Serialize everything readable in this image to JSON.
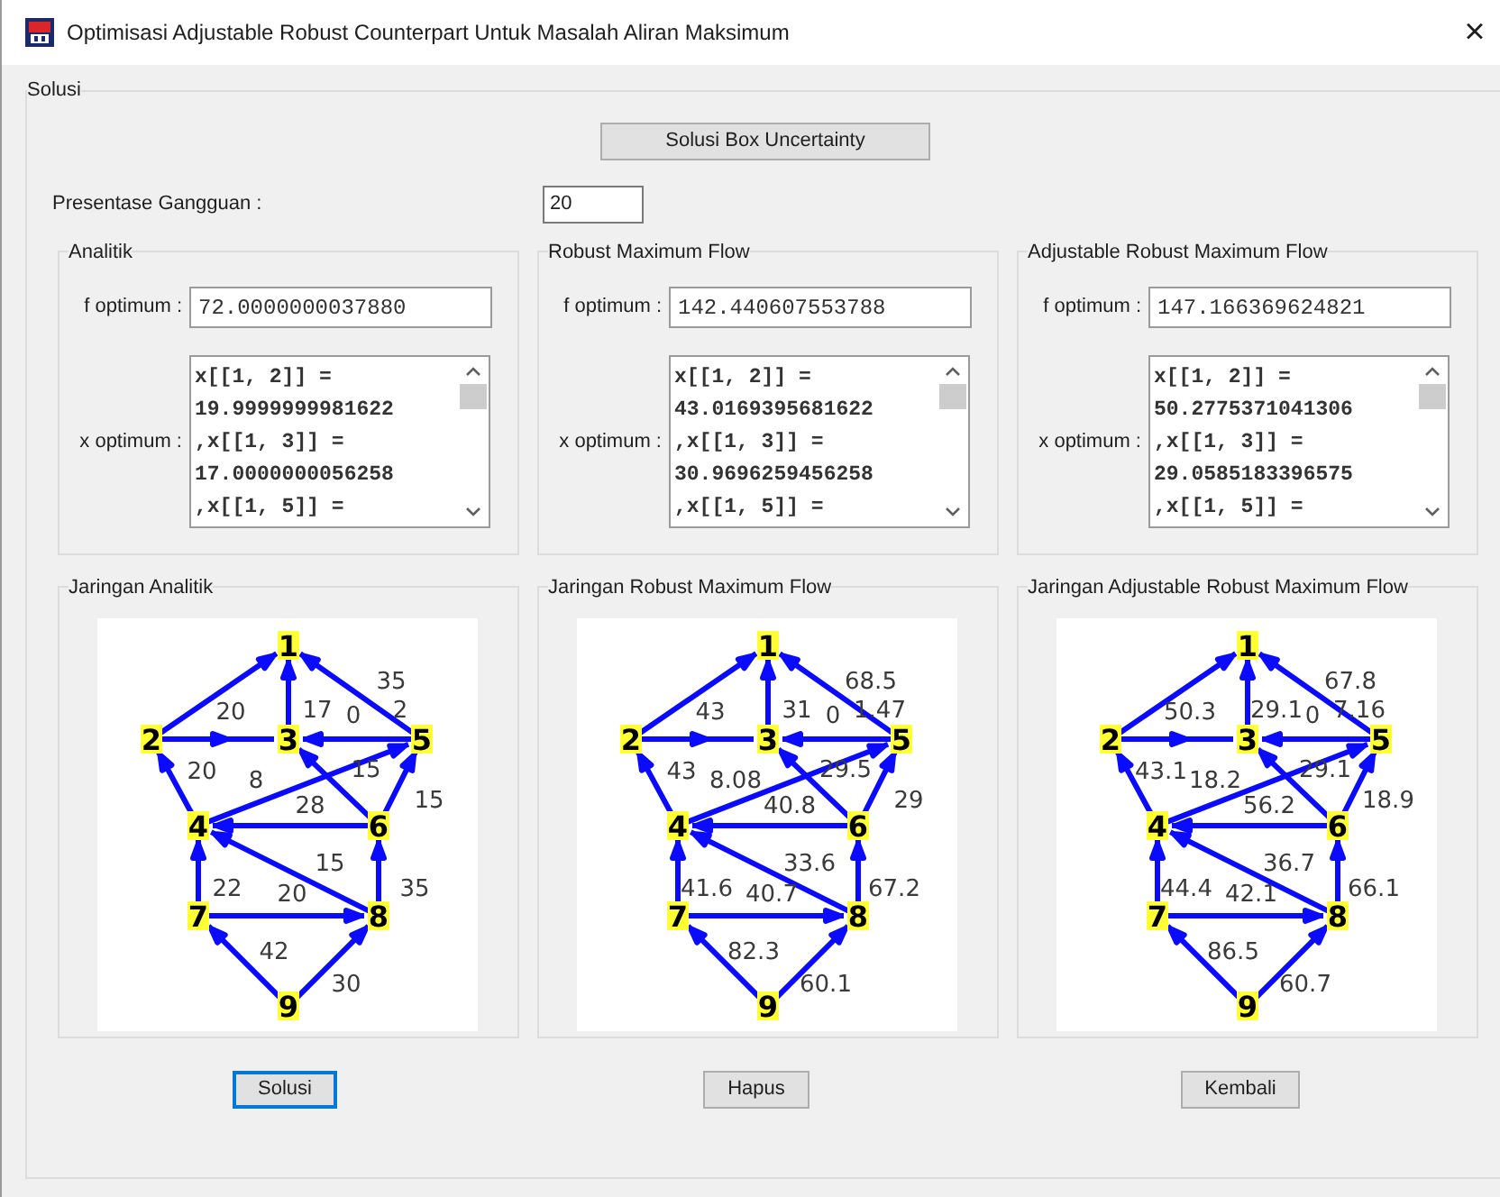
{
  "window": {
    "title": "Optimisasi Adjustable Robust Counterpart Untuk Masalah Aliran Maksimum",
    "close": "×"
  },
  "group": {
    "title": "Solusi"
  },
  "box_button": "Solusi Box Uncertainty",
  "disturbance": {
    "label": "Presentase Gangguan :",
    "value": "20"
  },
  "results": [
    {
      "title": "Analitik",
      "f_label": "f optimum :",
      "f_value": "72.0000000037880",
      "x_label": "x optimum :",
      "x_lines": [
        "x[[1, 2]] =",
        "19.9999999981622",
        ",x[[1, 3]] =",
        "17.0000000056258",
        ",x[[1, 5]] ="
      ]
    },
    {
      "title": "Robust Maximum Flow",
      "f_label": "f optimum :",
      "f_value": "142.440607553788",
      "x_label": "x optimum :",
      "x_lines": [
        "x[[1, 2]] =",
        "43.0169395681622",
        ",x[[1, 3]] =",
        "30.9696259456258",
        ",x[[1, 5]] ="
      ]
    },
    {
      "title": "Adjustable Robust Maximum Flow",
      "f_label": "f optimum :",
      "f_value": "147.166369624821",
      "x_label": "x optimum :",
      "x_lines": [
        "x[[1, 2]] =",
        "50.2775371041306",
        ",x[[1, 3]] =",
        "29.0585183396575",
        ",x[[1, 5]] ="
      ]
    }
  ],
  "networks": [
    {
      "title": "Jaringan Analitik",
      "nodes": [
        "1",
        "2",
        "3",
        "4",
        "5",
        "6",
        "7",
        "8",
        "9"
      ],
      "edge_labels": [
        "35",
        "20",
        "17",
        "0",
        "2",
        "20",
        "8",
        "15",
        "28",
        "15",
        "15",
        "22",
        "20",
        "35",
        "42",
        "30"
      ]
    },
    {
      "title": "Jaringan Robust Maximum Flow",
      "nodes": [
        "1",
        "2",
        "3",
        "4",
        "5",
        "6",
        "7",
        "8",
        "9"
      ],
      "edge_labels": [
        "68.5",
        "43",
        "31",
        "0",
        "1.47",
        "43",
        "8.08",
        "29.5",
        "40.8",
        "29",
        "33.6",
        "41.6",
        "40.7",
        "67.2",
        "82.3",
        "60.1"
      ]
    },
    {
      "title": "Jaringan Adjustable Robust Maximum Flow",
      "nodes": [
        "1",
        "2",
        "3",
        "4",
        "5",
        "6",
        "7",
        "8",
        "9"
      ],
      "edge_labels": [
        "67.8",
        "50.3",
        "29.1",
        "0",
        "7.16",
        "43.1",
        "18.2",
        "29.1",
        "56.2",
        "18.9",
        "36.7",
        "44.4",
        "42.1",
        "66.1",
        "86.5",
        "60.7"
      ]
    }
  ],
  "buttons": [
    {
      "label": "Solusi",
      "focused": true
    },
    {
      "label": "Hapus",
      "focused": false
    },
    {
      "label": "Kembali",
      "focused": false
    }
  ]
}
